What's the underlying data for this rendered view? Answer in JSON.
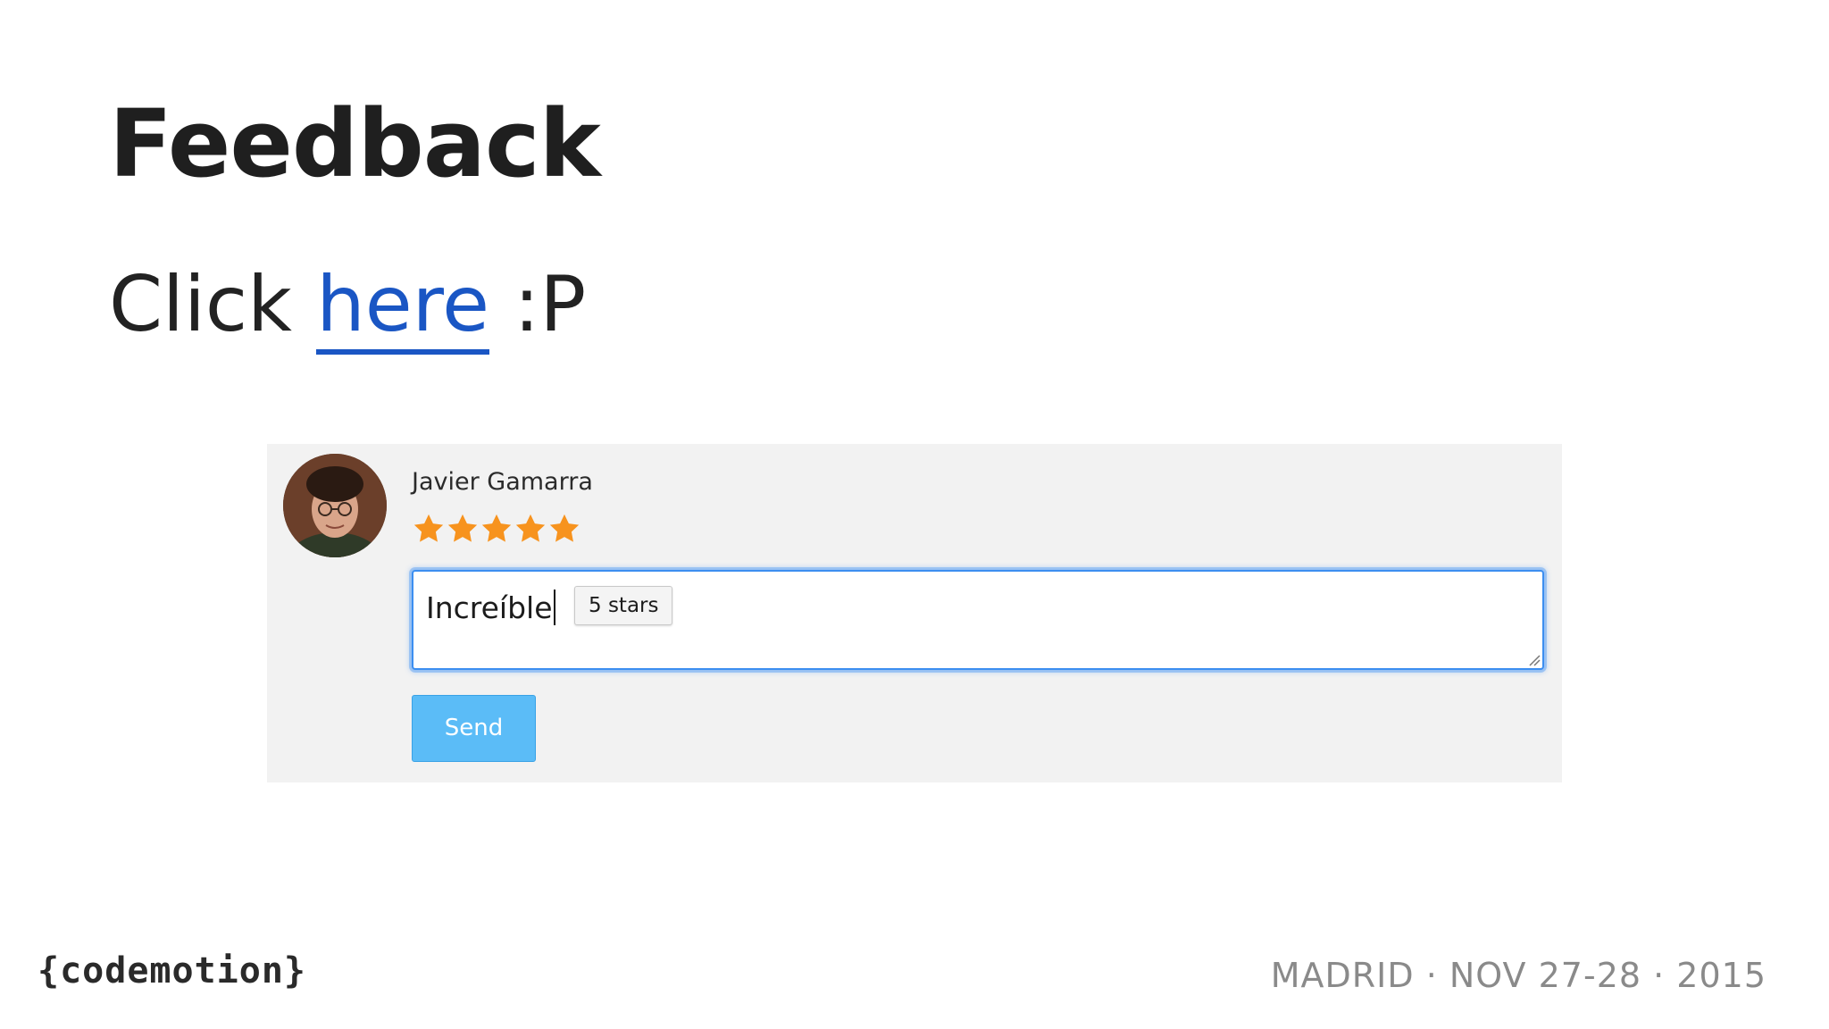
{
  "slide": {
    "title": "Feedback",
    "click_prefix": "Click",
    "link_text": "here",
    "click_suffix": ":P"
  },
  "widget": {
    "user_name": "Javier Gamarra",
    "rating": {
      "value": 5,
      "max": 5
    },
    "comment_value": "Increíble",
    "suggestion_chip": "5 stars",
    "send_label": "Send",
    "colors": {
      "star": "#f7931e",
      "send_button": "#5bbcf7",
      "focus_ring": "#3c8ef0"
    }
  },
  "footer": {
    "logo_text": "{codemotion}",
    "event": "MADRID · NOV 27-28 · 2015"
  }
}
